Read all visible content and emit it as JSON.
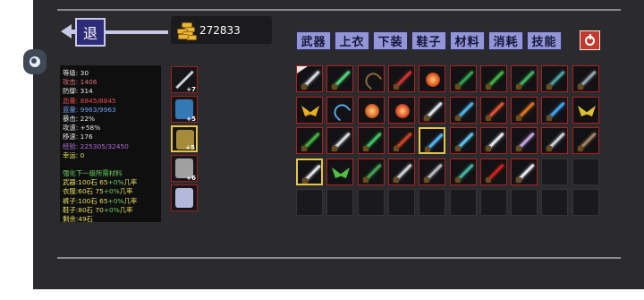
{
  "header": {
    "back_label": "退",
    "gold": "272833"
  },
  "tabs": [
    {
      "label": "武器"
    },
    {
      "label": "上衣"
    },
    {
      "label": "下装"
    },
    {
      "label": "鞋子"
    },
    {
      "label": "材料"
    },
    {
      "label": "消耗"
    },
    {
      "label": "技能"
    }
  ],
  "close_icon": "power-icon",
  "stats": [
    {
      "label": "等级:",
      "value": "30",
      "color": "#e6e6e6"
    },
    {
      "label": "攻击:",
      "value": "1406",
      "color": "#e46f6f"
    },
    {
      "label": "防御:",
      "value": "314",
      "color": "#e6e6e6"
    },
    {
      "label": "血量:",
      "value": "8845/8845",
      "color": "#e24a4a"
    },
    {
      "label": "蓝量:",
      "value": "9963/9963",
      "color": "#6f9ce8"
    },
    {
      "label": "暴击:",
      "value": "22%",
      "color": "#e6e6e6"
    },
    {
      "label": "攻速:",
      "value": "+58%",
      "color": "#e6e6e6"
    },
    {
      "label": "移速:",
      "value": "176",
      "color": "#e6e6e6"
    },
    {
      "label": "经验:",
      "value": "225305/32450",
      "color": "#b06cd8"
    },
    {
      "label": "幸运:",
      "value": "0",
      "color": "#e8de5a"
    }
  ],
  "enhance": {
    "title": "强化下一级所需材料",
    "rows": [
      {
        "text": "武器:100石 65",
        "bonus": "+0%",
        "suffix": "几率"
      },
      {
        "text": "衣服:60石 75",
        "bonus": "+0%",
        "suffix": "几率"
      },
      {
        "text": "裤子:100石 65",
        "bonus": "+0%",
        "suffix": "几率"
      },
      {
        "text": "鞋子:80石 70",
        "bonus": "+0%",
        "suffix": "几率"
      }
    ],
    "remaining": "剩余:49石"
  },
  "equipment": [
    {
      "slot": "weapon",
      "level": "+7",
      "icon": "sword-icon",
      "color": "#c8ccd6"
    },
    {
      "slot": "top",
      "level": "+5",
      "icon": "armor-icon",
      "color": "#3a8ad0"
    },
    {
      "slot": "bottom",
      "level": "+5",
      "icon": "pants-icon",
      "color": "#c0a040"
    },
    {
      "slot": "shoes",
      "level": "+6",
      "icon": "boots-icon",
      "color": "#b8b8b8"
    },
    {
      "slot": "accessory",
      "level": "",
      "icon": "wing-ornament-icon",
      "color": "#d0d6ff"
    }
  ],
  "inventory": [
    {
      "icon": "sword-icon",
      "color": "#d0d4dc",
      "kind": "blade",
      "badge": true
    },
    {
      "icon": "sword-icon",
      "color": "#4fd07a",
      "kind": "blade"
    },
    {
      "icon": "bow-icon",
      "color": "#8a6a3a",
      "kind": "bow"
    },
    {
      "icon": "sword-icon",
      "color": "#d03030",
      "kind": "blade"
    },
    {
      "icon": "fire-orb-icon",
      "color": "#e05a20",
      "kind": "orb"
    },
    {
      "icon": "sword-icon",
      "color": "#30a050",
      "kind": "blade"
    },
    {
      "icon": "sword-icon",
      "color": "#40b040",
      "kind": "blade"
    },
    {
      "icon": "sword-icon",
      "color": "#40b060",
      "kind": "blade"
    },
    {
      "icon": "spear-icon",
      "color": "#4aa0a0",
      "kind": "blade"
    },
    {
      "icon": "axe-icon",
      "color": "#8fa0a8",
      "kind": "blade"
    },
    {
      "icon": "wings-icon",
      "color": "#e8b020",
      "kind": "wings"
    },
    {
      "icon": "bow-icon",
      "color": "#5aa8e8",
      "kind": "bow"
    },
    {
      "icon": "fire-orb-icon",
      "color": "#e06a2a",
      "kind": "orb"
    },
    {
      "icon": "fire-orb-icon",
      "color": "#e0502a",
      "kind": "orb"
    },
    {
      "icon": "sword-icon",
      "color": "#d8dce4",
      "kind": "blade"
    },
    {
      "icon": "sword-icon",
      "color": "#50b0e0",
      "kind": "blade"
    },
    {
      "icon": "flame-sword-icon",
      "color": "#e05030",
      "kind": "blade"
    },
    {
      "icon": "flame-sword-icon",
      "color": "#e07020",
      "kind": "blade"
    },
    {
      "icon": "ice-sword-icon",
      "color": "#40a0f0",
      "kind": "blade"
    },
    {
      "icon": "wings-icon",
      "color": "#e0c030",
      "kind": "wings"
    },
    {
      "icon": "sword-icon",
      "color": "#40b040",
      "kind": "blade"
    },
    {
      "icon": "sword-icon",
      "color": "#d0d4dc",
      "kind": "blade"
    },
    {
      "icon": "sword-icon",
      "color": "#40c060",
      "kind": "blade"
    },
    {
      "icon": "flame-sword-icon",
      "color": "#d04020",
      "kind": "blade"
    },
    {
      "icon": "ice-sword-icon",
      "color": "#50b0f0",
      "kind": "blade",
      "highlight": true
    },
    {
      "icon": "sword-icon",
      "color": "#5ac0e8",
      "kind": "blade"
    },
    {
      "icon": "sword-icon",
      "color": "#e0e4ec",
      "kind": "blade"
    },
    {
      "icon": "sword-icon",
      "color": "#c0a0e0",
      "kind": "blade"
    },
    {
      "icon": "sword-icon",
      "color": "#c8ccd4",
      "kind": "blade"
    },
    {
      "icon": "spear-icon",
      "color": "#a08060",
      "kind": "blade"
    },
    {
      "icon": "sword-icon",
      "color": "#d8dce4",
      "kind": "blade",
      "highlight": true
    },
    {
      "icon": "wings-icon",
      "color": "#50c040",
      "kind": "wings"
    },
    {
      "icon": "sword-icon",
      "color": "#40a050",
      "kind": "blade"
    },
    {
      "icon": "sword-icon",
      "color": "#c8ccd4",
      "kind": "blade"
    },
    {
      "icon": "spear-icon",
      "color": "#b0b4bc",
      "kind": "blade"
    },
    {
      "icon": "sword-icon",
      "color": "#40b0a0",
      "kind": "blade"
    },
    {
      "icon": "flame-sword-icon",
      "color": "#d02020",
      "kind": "blade"
    },
    {
      "icon": "sword-icon",
      "color": "#e0e4ec",
      "kind": "blade"
    }
  ],
  "inventory_total_slots": 50
}
